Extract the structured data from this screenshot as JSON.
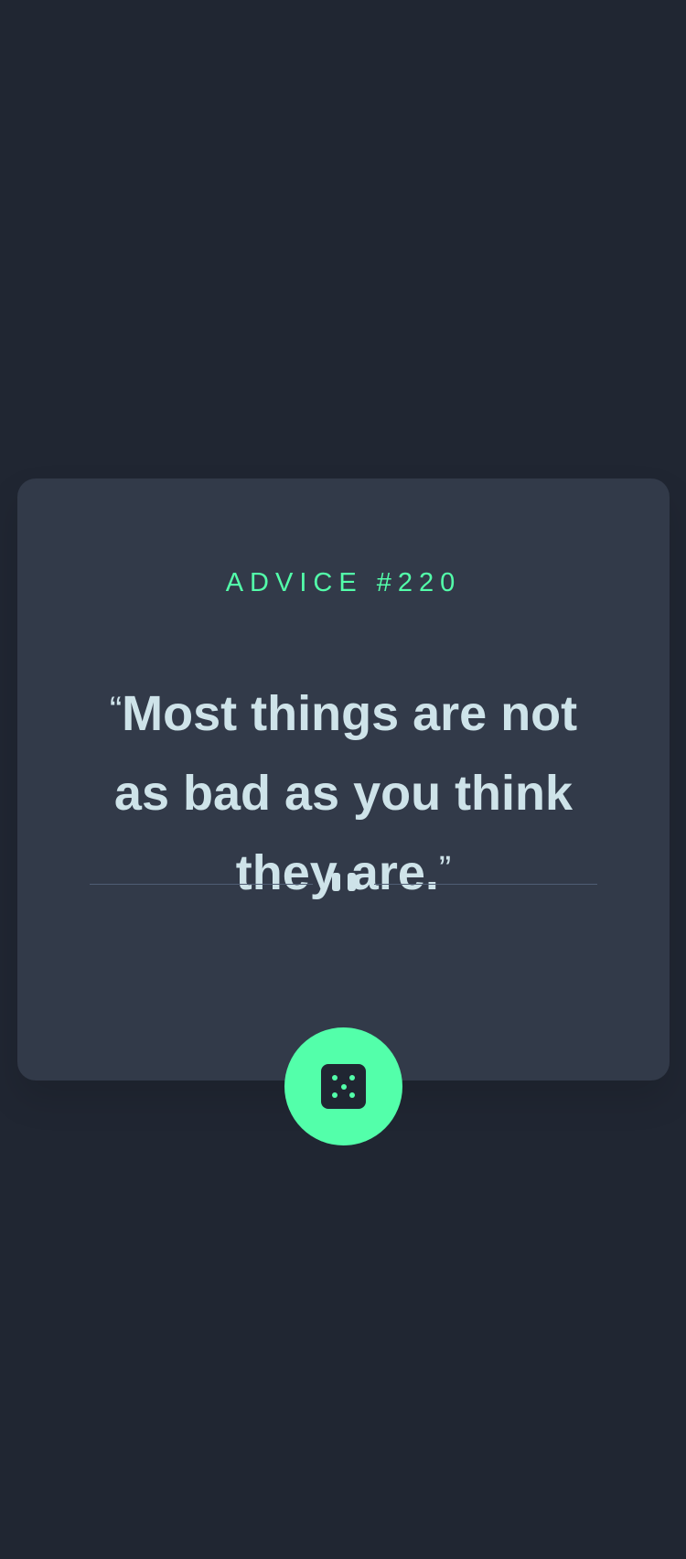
{
  "advice": {
    "label": "ADVICE #220",
    "open_quote": "“",
    "text": "Most things are not as bad as you think they are.",
    "close_quote": "”"
  },
  "divider": {
    "icon": "pause-icon"
  },
  "generate_button": {
    "icon": "dice-icon"
  },
  "colors": {
    "background": "#202632",
    "card": "#323a49",
    "accent": "#53ffaa",
    "quote_text": "#cee3e9",
    "divider_line": "#4f5d74"
  }
}
